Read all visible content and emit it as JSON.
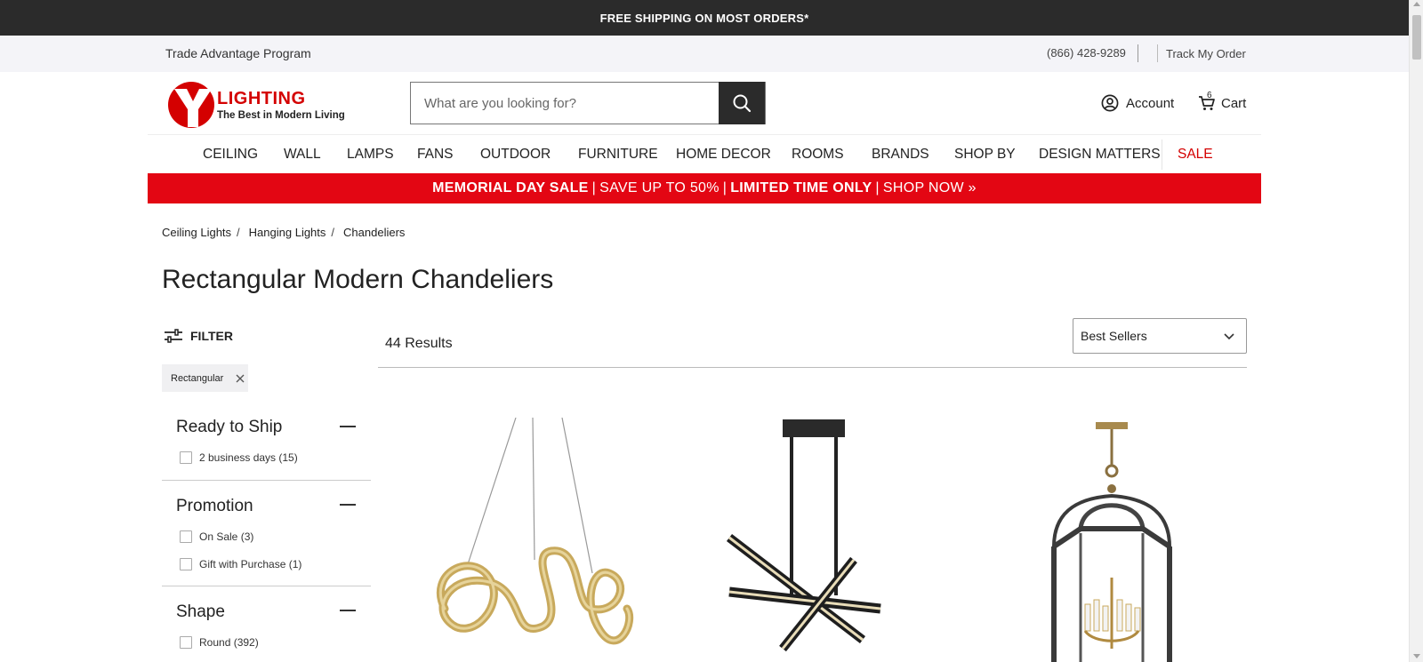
{
  "promo_bar": {
    "text": "FREE SHIPPING ON MOST ORDERS*"
  },
  "utility_bar": {
    "trade_program": "Trade Advantage Program",
    "phone": "(866) 428-9289",
    "track_order": "Track My Order"
  },
  "logo": {
    "wordmark": "LIGHTING",
    "tagline": "The Best in Modern Living",
    "brand_color": "#d40000"
  },
  "search": {
    "placeholder": "What are you looking for?",
    "button_icon": "search-icon"
  },
  "account": {
    "label": "Account",
    "icon": "user-circle-icon"
  },
  "cart": {
    "label": "Cart",
    "count": "6",
    "icon": "cart-icon"
  },
  "nav": {
    "items": [
      {
        "label": "CEILING"
      },
      {
        "label": "WALL"
      },
      {
        "label": "LAMPS"
      },
      {
        "label": "FANS"
      },
      {
        "label": "OUTDOOR"
      },
      {
        "label": "FURNITURE"
      },
      {
        "label": "HOME DECOR"
      },
      {
        "label": "ROOMS"
      },
      {
        "label": "BRANDS"
      },
      {
        "label": "SHOP BY"
      },
      {
        "label": "DESIGN MATTERS"
      },
      {
        "label": "SALE"
      }
    ]
  },
  "sale_banner": {
    "part1": "MEMORIAL DAY SALE",
    "sep1": "|",
    "part2": "SAVE UP TO 50%",
    "sep2": "|",
    "part3": "LIMITED TIME ONLY",
    "sep3": "|",
    "part4": "SHOP NOW »",
    "color": "#e30613"
  },
  "breadcrumb": {
    "items": [
      {
        "label": "Ceiling Lights",
        "sep": "/"
      },
      {
        "label": "Hanging Lights",
        "sep": "/"
      },
      {
        "label": "Chandeliers"
      }
    ]
  },
  "page_title": "Rectangular Modern Chandeliers",
  "filter": {
    "heading": "FILTER",
    "active_chip": "Rectangular",
    "facets": [
      {
        "title": "Ready to Ship",
        "options": [
          {
            "label": "2 business days (15)"
          }
        ]
      },
      {
        "title": "Promotion",
        "options": [
          {
            "label": "On Sale (3)"
          },
          {
            "label": "Gift with Purchase (1)"
          }
        ]
      },
      {
        "title": "Shape",
        "options": [
          {
            "label": "Round (392)"
          }
        ]
      }
    ]
  },
  "results": {
    "count_label": "44 Results",
    "sort_selected": "Best Sellers"
  }
}
